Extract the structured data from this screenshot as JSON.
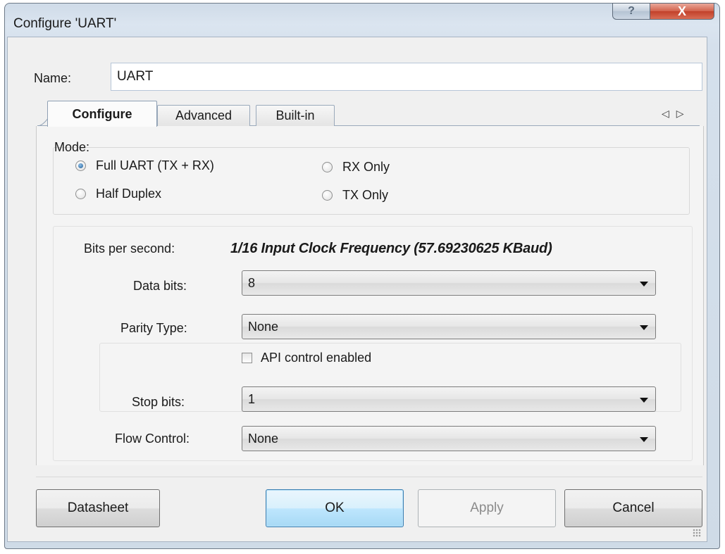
{
  "window": {
    "title": "Configure 'UART'",
    "help_label": "?",
    "close_label": "X"
  },
  "name_field": {
    "label": "Name:",
    "value": "UART"
  },
  "tabs": [
    {
      "label": "Configure",
      "active": true
    },
    {
      "label": "Advanced",
      "active": false
    },
    {
      "label": "Built-in",
      "active": false
    }
  ],
  "tab_scroll": {
    "left": "◁",
    "right": "▷"
  },
  "mode": {
    "label": "Mode:",
    "options": [
      {
        "label": "Full UART (TX + RX)",
        "selected": true
      },
      {
        "label": "Half Duplex",
        "selected": false
      },
      {
        "label": "RX Only",
        "selected": false
      },
      {
        "label": "TX Only",
        "selected": false
      }
    ]
  },
  "settings": {
    "bps_label": "Bits per second:",
    "bps_value": "1/16 Input Clock Frequency (57.69230625 KBaud)",
    "data_bits_label": "Data bits:",
    "data_bits_value": "8",
    "parity_label": "Parity Type:",
    "parity_value": "None",
    "api_control_label": "API control enabled",
    "api_control_checked": false,
    "stop_bits_label": "Stop bits:",
    "stop_bits_value": "1",
    "flow_control_label": "Flow Control:",
    "flow_control_value": "None"
  },
  "buttons": {
    "datasheet": "Datasheet",
    "ok": "OK",
    "apply": "Apply",
    "cancel": "Cancel"
  },
  "colors": {
    "accent_default_button": "#3c7fb1",
    "close_button": "#c2402a",
    "selected_radio": "#1e5c93"
  }
}
